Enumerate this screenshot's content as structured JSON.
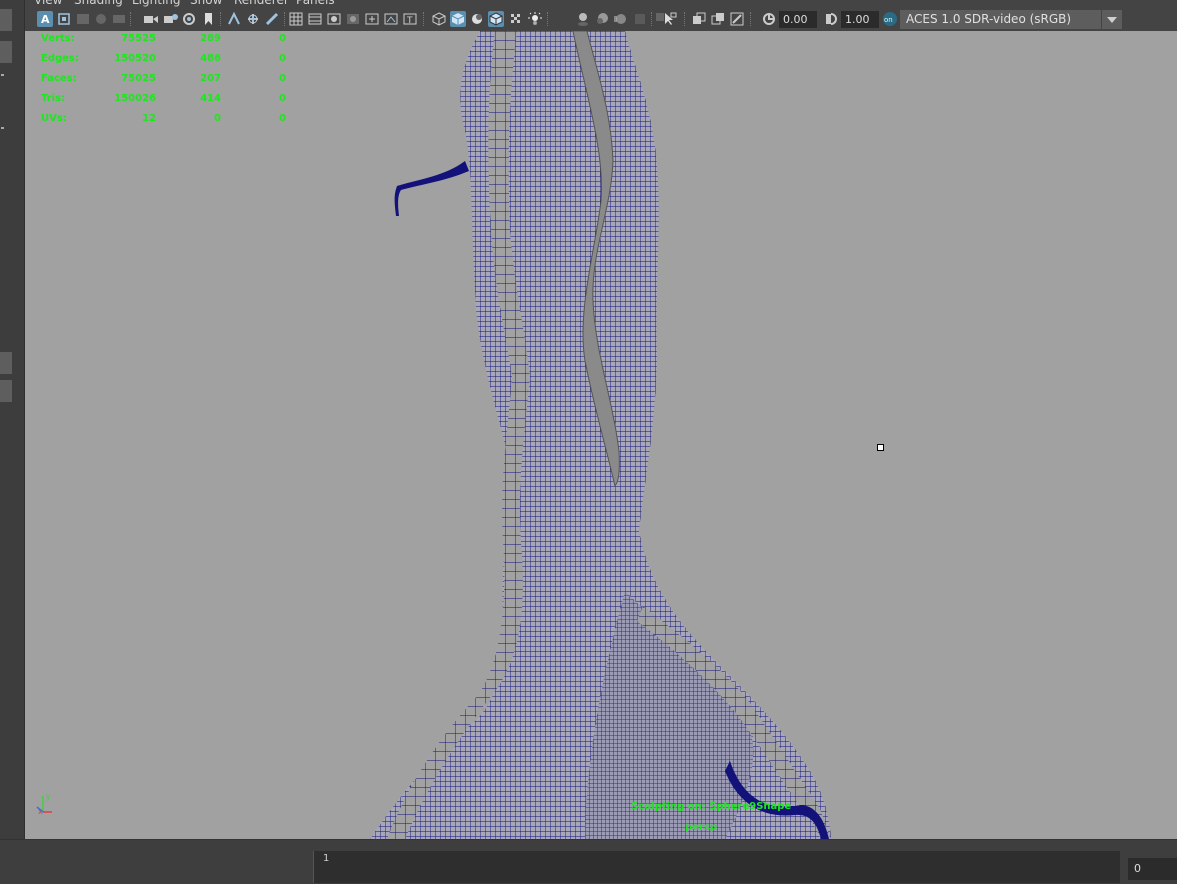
{
  "menubar": {
    "items": [
      {
        "label": "View"
      },
      {
        "label": "Shading"
      },
      {
        "label": "Lighting"
      },
      {
        "label": "Show"
      },
      {
        "label": "Renderer"
      },
      {
        "label": "Panels"
      }
    ]
  },
  "toolbar": {
    "exposure_value": "0.00",
    "gamma_value": "1.00",
    "color_space": "ACES 1.0 SDR-video (sRGB)",
    "active_color": "#5a8fb0",
    "icons": [
      "select-camera-icon",
      "camera-attributes-icon",
      "bookmark-icon",
      "image-plane-icon",
      "2d-pan-zoom-icon",
      "camera-icon",
      "film-gate-icon",
      "resolution-gate-icon",
      "gate-mask-icon",
      "field-chart-icon",
      "safe-action-icon",
      "safe-title-icon",
      "wireframe-icon",
      "smooth-shade-icon",
      "default-material-icon",
      "wireframe-on-shaded-icon",
      "textured-icon",
      "use-lights-icon",
      "shadows-icon",
      "ambient-occlusion-icon",
      "motion-blur-icon",
      "anti-aliasing-icon",
      "depth-of-field-icon",
      "isolate-select-icon",
      "xray-icon",
      "xray-joints-icon",
      "xray-components-icon",
      "exposure-icon",
      "gamma-icon",
      "color-management-icon"
    ]
  },
  "hud": {
    "rows": [
      {
        "label": "Verts:",
        "total": "75525",
        "selected": "289",
        "comp": "0"
      },
      {
        "label": "Edges:",
        "total": "150520",
        "selected": "486",
        "comp": "0"
      },
      {
        "label": "Faces:",
        "total": "75025",
        "selected": "207",
        "comp": "0"
      },
      {
        "label": "Tris:",
        "total": "150026",
        "selected": "414",
        "comp": "0"
      },
      {
        "label": "UVs:",
        "total": "12",
        "selected": "0",
        "comp": "0"
      }
    ],
    "sculpting_status": "Sculpting on: Sphere9Shape",
    "camera_name": "persp",
    "hud_color": "#1ee61e"
  },
  "viewport": {
    "background": "#a1a1a1",
    "wire_color": "#12127a",
    "axis_labels": {
      "y": "y",
      "x": "x"
    }
  },
  "timeline": {
    "start_frame_label": "1",
    "current_frame": "0"
  }
}
